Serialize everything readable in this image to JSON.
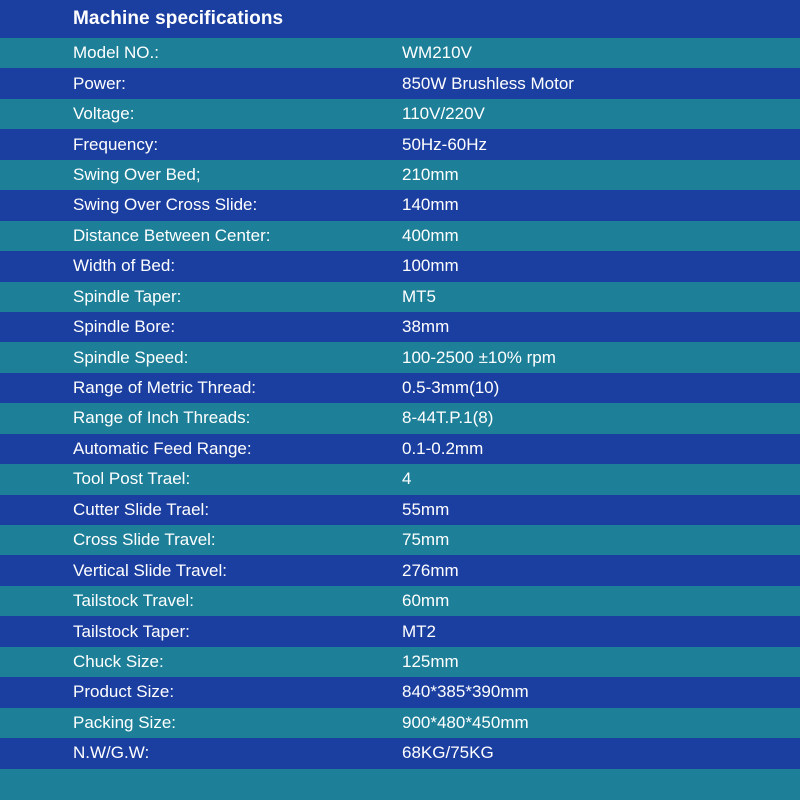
{
  "title": "Machine specifications",
  "specs": [
    {
      "label": "Model NO.:",
      "value": "WM210V"
    },
    {
      "label": "Power:",
      "value": "850W Brushless Motor"
    },
    {
      "label": "Voltage:",
      "value": "110V/220V"
    },
    {
      "label": "Frequency:",
      "value": "50Hz-60Hz"
    },
    {
      "label": "Swing Over Bed;",
      "value": "210mm"
    },
    {
      "label": "Swing Over Cross Slide:",
      "value": "140mm"
    },
    {
      "label": "Distance Between Center:",
      "value": "400mm"
    },
    {
      "label": "Width of Bed:",
      "value": "100mm"
    },
    {
      "label": "Spindle Taper:",
      "value": "MT5"
    },
    {
      "label": "Spindle Bore:",
      "value": "38mm"
    },
    {
      "label": "Spindle Speed:",
      "value": "100-2500 ±10% rpm"
    },
    {
      "label": "Range of Metric Thread:",
      "value": "0.5-3mm(10)"
    },
    {
      "label": "Range of Inch Threads:",
      "value": "8-44T.P.1(8)"
    },
    {
      "label": "Automatic Feed Range:",
      "value": "0.1-0.2mm"
    },
    {
      "label": "Tool Post Trael:",
      "value": "4"
    },
    {
      "label": "Cutter Slide Trael:",
      "value": "55mm"
    },
    {
      "label": "Cross Slide Travel:",
      "value": "75mm"
    },
    {
      "label": "Vertical Slide Travel:",
      "value": "276mm"
    },
    {
      "label": "Tailstock Travel:",
      "value": "60mm"
    },
    {
      "label": "Tailstock Taper:",
      "value": "MT2"
    },
    {
      "label": "Chuck Size:",
      "value": "125mm"
    },
    {
      "label": "Product Size:",
      "value": "840*385*390mm"
    },
    {
      "label": "Packing Size:",
      "value": "900*480*450mm"
    },
    {
      "label": "N.W/G.W:",
      "value": "68KG/75KG"
    }
  ],
  "colors": {
    "blue_row": "#1b3fa0",
    "teal_row": "#1d7f98",
    "text": "#ffffff"
  }
}
